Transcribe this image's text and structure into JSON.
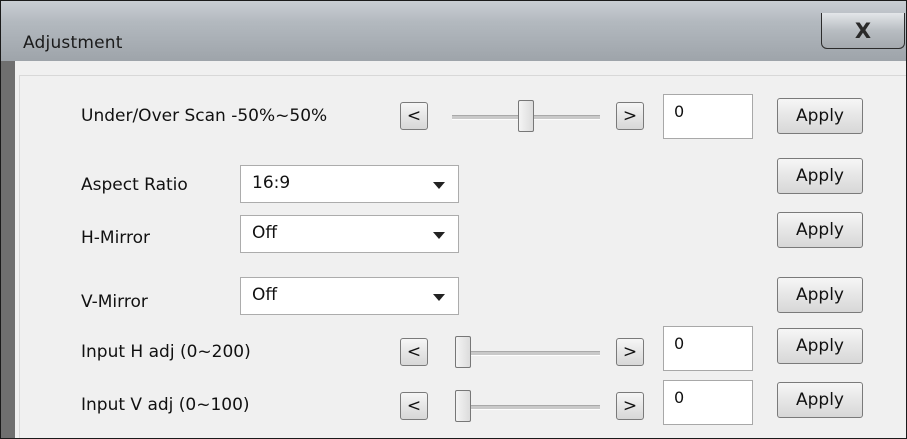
{
  "window": {
    "title": "Adjustment",
    "close_label": "X"
  },
  "scan": {
    "label": "Under/Over Scan -50%~50%",
    "dec": "<",
    "inc": ">",
    "value": "0",
    "apply": "Apply",
    "slider_fraction": 0.5
  },
  "aspect": {
    "label": "Aspect Ratio",
    "value": "16:9",
    "apply": "Apply"
  },
  "hmirror": {
    "label": "H-Mirror",
    "value": "Off",
    "apply": "Apply"
  },
  "vmirror": {
    "label": "V-Mirror",
    "value": "Off",
    "apply": "Apply"
  },
  "inputh": {
    "label": "Input H adj (0~200)",
    "dec": "<",
    "inc": ">",
    "value": "0",
    "apply": "Apply",
    "slider_fraction": 0
  },
  "inputv": {
    "label": "Input V adj (0~100)",
    "dec": "<",
    "inc": ">",
    "value": "0",
    "apply": "Apply",
    "slider_fraction": 0
  }
}
